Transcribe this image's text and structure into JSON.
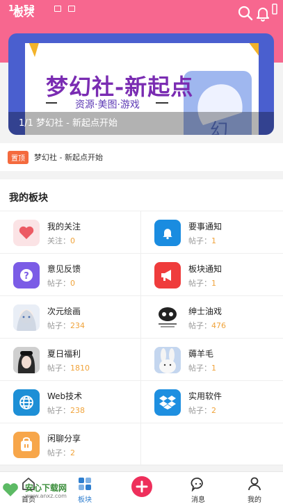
{
  "status": {
    "time": "11:53"
  },
  "header": {
    "title": "板块",
    "search_icon": "search-icon",
    "notify_icon": "bell-icon",
    "bg": "#f7678f"
  },
  "banner": {
    "art_title": "梦幻社-新起点",
    "art_subtitle": "资源·美图·游戏",
    "art_glyph": "幻",
    "caption": "1/1 梦幻社 - 新起点开始"
  },
  "sticky": {
    "badge": "置顶",
    "text": "梦幻社 - 新起点开始"
  },
  "boards": {
    "title": "我的板块",
    "items": [
      {
        "name": "我的关注",
        "stat_label": "关注：",
        "stat_value": "0",
        "icon": "heart-icon"
      },
      {
        "name": "要事通知",
        "stat_label": "帖子：",
        "stat_value": "1",
        "icon": "bell-icon"
      },
      {
        "name": "意见反馈",
        "stat_label": "帖子：",
        "stat_value": "0",
        "icon": "question-icon"
      },
      {
        "name": "板块通知",
        "stat_label": "帖子：",
        "stat_value": "1",
        "icon": "megaphone-icon"
      },
      {
        "name": "次元绘画",
        "stat_label": "帖子：",
        "stat_value": "234",
        "icon": "anime-girl-avatar"
      },
      {
        "name": "绅士油戏",
        "stat_label": "帖子：",
        "stat_value": "476",
        "icon": "meme-avatar"
      },
      {
        "name": "夏日福利",
        "stat_label": "帖子：",
        "stat_value": "1810",
        "icon": "girl-photo-avatar"
      },
      {
        "name": "薅羊毛",
        "stat_label": "帖子：",
        "stat_value": "1",
        "icon": "bunny-avatar"
      },
      {
        "name": "Web技术",
        "stat_label": "帖子：",
        "stat_value": "238",
        "icon": "globe-icon"
      },
      {
        "name": "实用软件",
        "stat_label": "帖子：",
        "stat_value": "2",
        "icon": "dropbox-icon"
      },
      {
        "name": "闲聊分享",
        "stat_label": "帖子：",
        "stat_value": "2",
        "icon": "chat-bag-icon"
      }
    ]
  },
  "tabbar": {
    "tabs": [
      {
        "label": "首页",
        "icon": "home-icon"
      },
      {
        "label": "板块",
        "icon": "grid-icon"
      },
      {
        "label": "消息",
        "icon": "message-icon"
      },
      {
        "label": "我的",
        "icon": "person-icon"
      }
    ],
    "publish_icon": "plus-icon"
  },
  "watermark": {
    "brand": "安心下载网",
    "url": "www.anxz.com"
  },
  "colors": {
    "accent": "#f7678f",
    "stat_number": "#f0a33a",
    "sticky_badge": "#f46a3e",
    "tab_active": "#2e7ecf",
    "publish": "#ee2f5b"
  }
}
